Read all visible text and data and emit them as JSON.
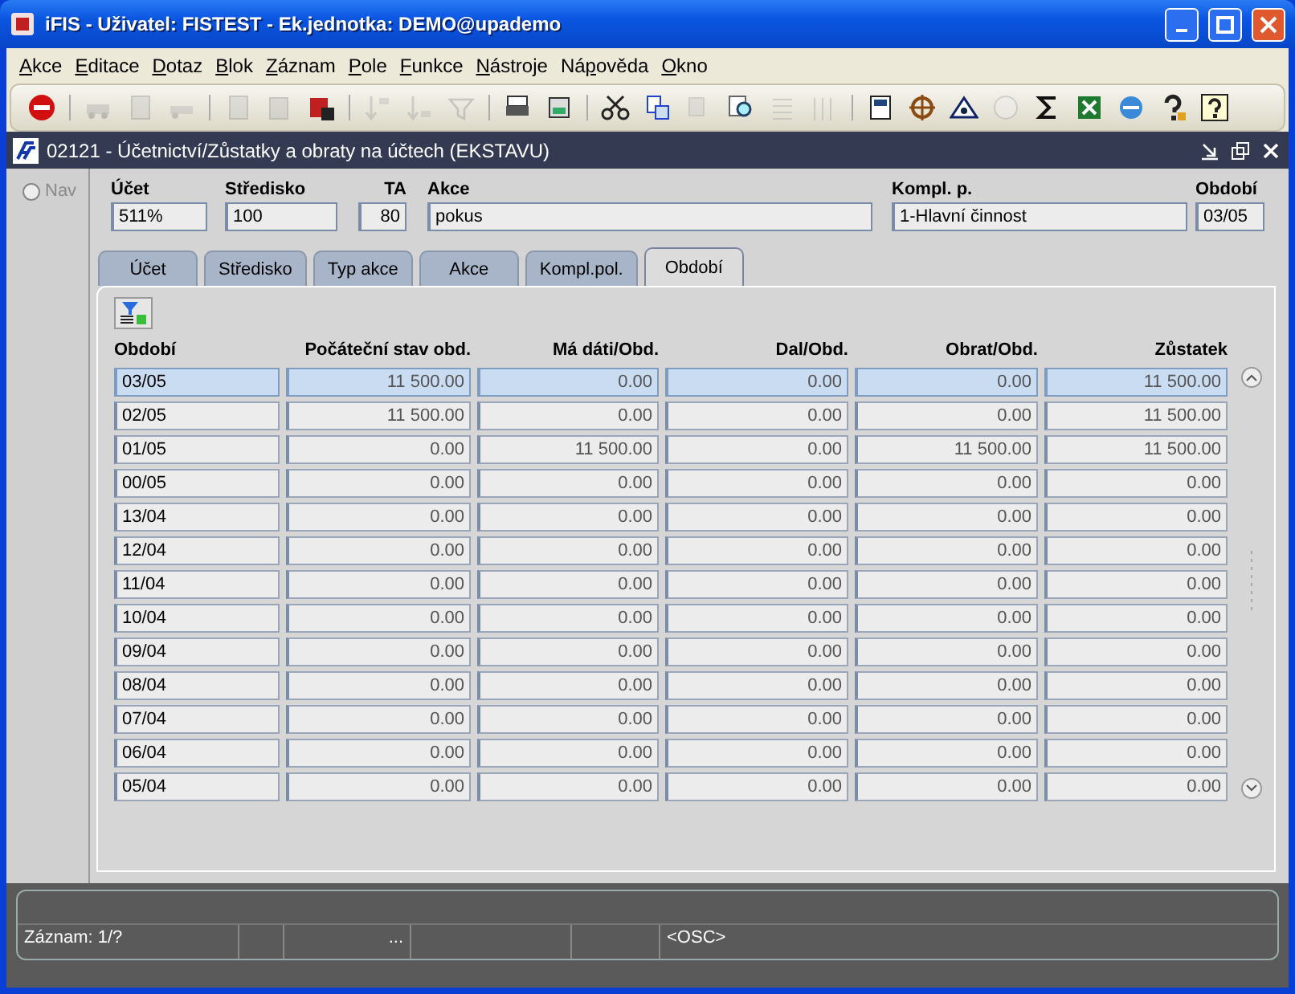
{
  "window": {
    "title": "iFIS - Uživatel: FISTEST - Ek.jednotka: DEMO@upademo"
  },
  "menu": [
    {
      "key": "A",
      "after": "kce"
    },
    {
      "key": "E",
      "after": "ditace"
    },
    {
      "key": "D",
      "after": "otaz"
    },
    {
      "key": "B",
      "after": "lok"
    },
    {
      "key": "Z",
      "after": "áznam"
    },
    {
      "key": "P",
      "after": "ole"
    },
    {
      "key": "F",
      "after": "unkce"
    },
    {
      "key": "N",
      "after": "ástroje"
    },
    {
      "before": "Ná",
      "key": "p",
      "after": "ověda"
    },
    {
      "key": "O",
      "after": "kno"
    }
  ],
  "toolbar": [
    {
      "disabled": false
    },
    {
      "disabled": true
    },
    {
      "disabled": true
    },
    {
      "disabled": true
    },
    {
      "disabled": true
    },
    {
      "disabled": true
    },
    {
      "disabled": false
    },
    {
      "disabled": true
    },
    {
      "disabled": true
    },
    {
      "disabled": true
    },
    {
      "disabled": false
    },
    {
      "disabled": false
    },
    {
      "disabled": false
    },
    {
      "disabled": false
    },
    {
      "disabled": true
    },
    {
      "disabled": false
    },
    {
      "disabled": true
    },
    {
      "disabled": true
    },
    {
      "disabled": false
    },
    {
      "disabled": false
    },
    {
      "disabled": false
    },
    {
      "disabled": true
    },
    {
      "disabled": false
    },
    {
      "disabled": false
    },
    {
      "disabled": false
    },
    {
      "disabled": false
    },
    {
      "disabled": false
    }
  ],
  "form": {
    "title": "02121 - Účetnictví/Zůstatky a obraty na účtech (EKSTAVU)",
    "nav": {
      "label": "Nav",
      "selected": false
    },
    "fields": [
      {
        "label": "Účet",
        "value": "511%"
      },
      {
        "label": "Středisko",
        "value": "100"
      },
      {
        "label": "TA",
        "value": "80"
      },
      {
        "label": "Akce",
        "value": "pokus"
      },
      {
        "label": "Kompl. p.",
        "value": "1-Hlavní činnost"
      },
      {
        "label": "Období",
        "value": "03/05"
      }
    ],
    "tabs": [
      {
        "label": "Účet",
        "selected": false
      },
      {
        "label": "Středisko",
        "selected": false
      },
      {
        "label": "Typ akce",
        "selected": false
      },
      {
        "label": "Akce",
        "selected": false
      },
      {
        "label": "Kompl.pol.",
        "selected": false
      },
      {
        "label": "Období",
        "selected": true
      }
    ],
    "table": {
      "columns": [
        "Období",
        "Počáteční stav obd.",
        "Má dáti/Obd.",
        "Dal/Obd.",
        "Obrat/Obd.",
        "Zůstatek"
      ],
      "rows": [
        {
          "selected": true,
          "cells": [
            "03/05",
            "11 500.00",
            "0.00",
            "0.00",
            "0.00",
            "11 500.00"
          ]
        },
        {
          "selected": false,
          "cells": [
            "02/05",
            "11 500.00",
            "0.00",
            "0.00",
            "0.00",
            "11 500.00"
          ]
        },
        {
          "selected": false,
          "cells": [
            "01/05",
            "0.00",
            "11 500.00",
            "0.00",
            "11 500.00",
            "11 500.00"
          ]
        },
        {
          "selected": false,
          "cells": [
            "00/05",
            "0.00",
            "0.00",
            "0.00",
            "0.00",
            "0.00"
          ]
        },
        {
          "selected": false,
          "cells": [
            "13/04",
            "0.00",
            "0.00",
            "0.00",
            "0.00",
            "0.00"
          ]
        },
        {
          "selected": false,
          "cells": [
            "12/04",
            "0.00",
            "0.00",
            "0.00",
            "0.00",
            "0.00"
          ]
        },
        {
          "selected": false,
          "cells": [
            "11/04",
            "0.00",
            "0.00",
            "0.00",
            "0.00",
            "0.00"
          ]
        },
        {
          "selected": false,
          "cells": [
            "10/04",
            "0.00",
            "0.00",
            "0.00",
            "0.00",
            "0.00"
          ]
        },
        {
          "selected": false,
          "cells": [
            "09/04",
            "0.00",
            "0.00",
            "0.00",
            "0.00",
            "0.00"
          ]
        },
        {
          "selected": false,
          "cells": [
            "08/04",
            "0.00",
            "0.00",
            "0.00",
            "0.00",
            "0.00"
          ]
        },
        {
          "selected": false,
          "cells": [
            "07/04",
            "0.00",
            "0.00",
            "0.00",
            "0.00",
            "0.00"
          ]
        },
        {
          "selected": false,
          "cells": [
            "06/04",
            "0.00",
            "0.00",
            "0.00",
            "0.00",
            "0.00"
          ]
        },
        {
          "selected": false,
          "cells": [
            "05/04",
            "0.00",
            "0.00",
            "0.00",
            "0.00",
            "0.00"
          ]
        }
      ]
    }
  },
  "status_bar": {
    "record": "Záznam: 1/?",
    "segment_3": "...",
    "mode": "<OSC>"
  }
}
